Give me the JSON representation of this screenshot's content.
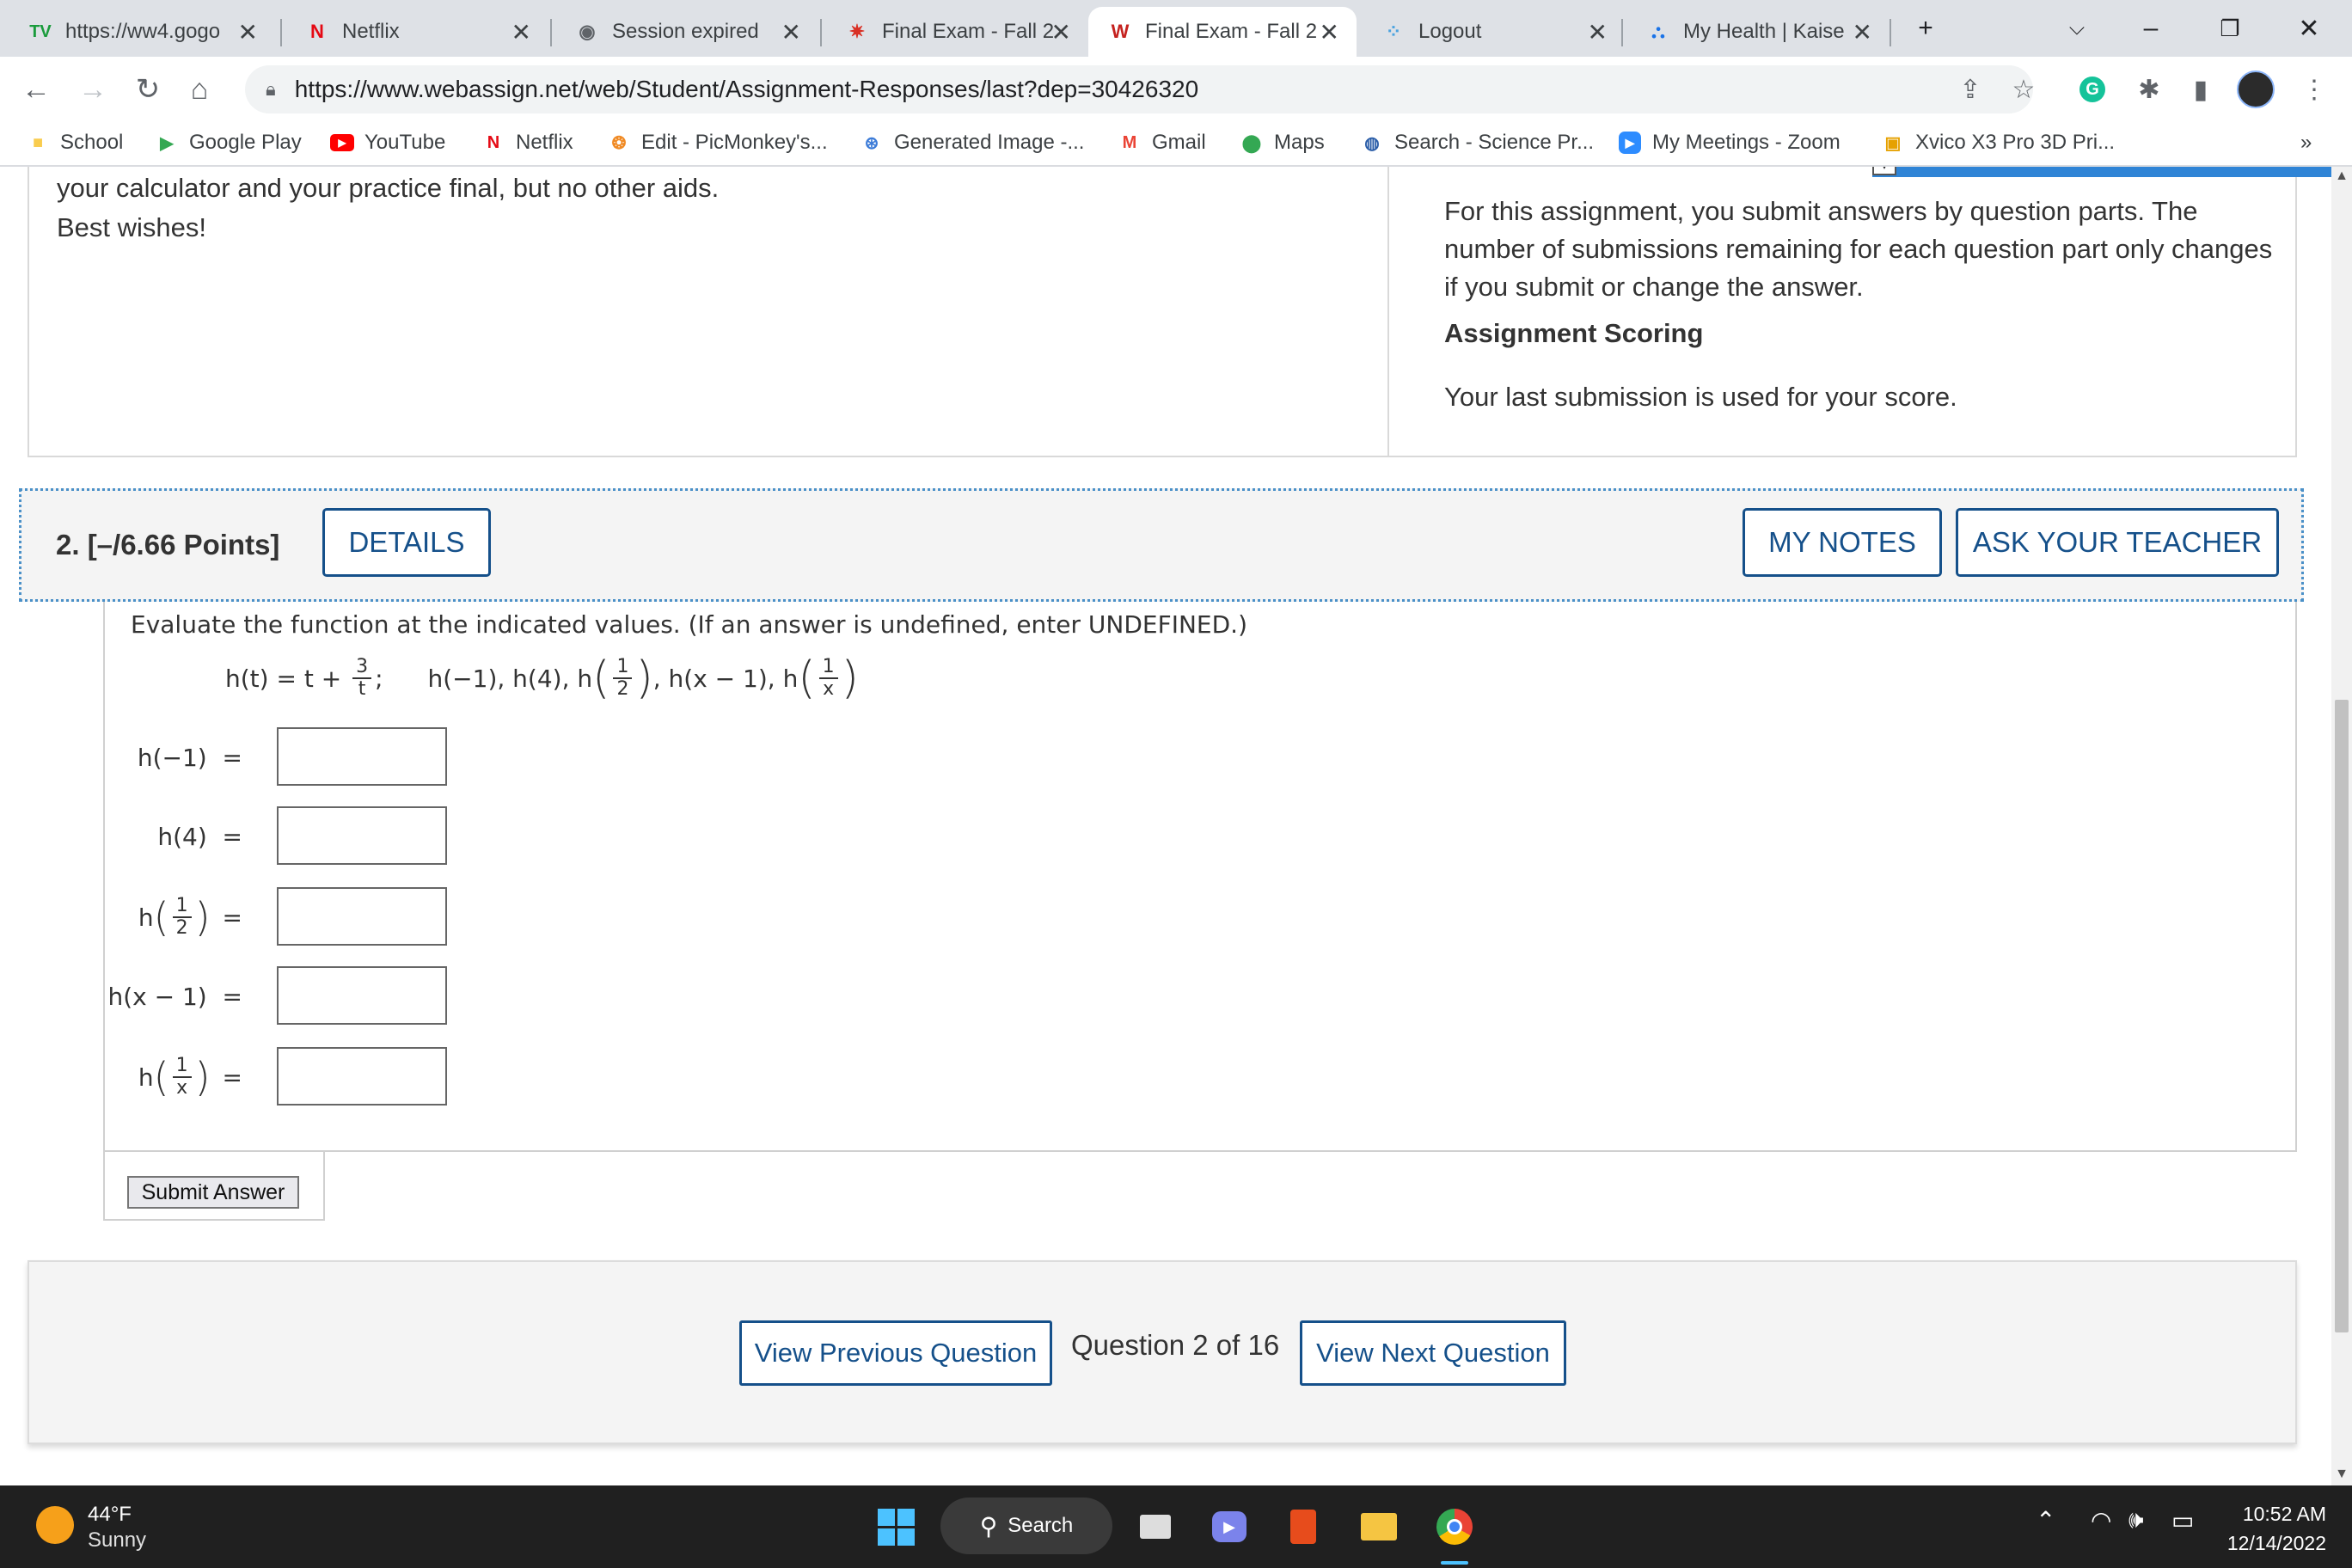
{
  "browser": {
    "tabs": [
      {
        "title": "https://ww4.gogo",
        "favicon": "tv-icon",
        "active": false
      },
      {
        "title": "Netflix",
        "favicon": "netflix-icon",
        "active": false
      },
      {
        "title": "Session expired",
        "favicon": "globe-icon",
        "active": false
      },
      {
        "title": "Final Exam - Fall 2",
        "favicon": "gear-logo-icon",
        "active": false
      },
      {
        "title": "Final Exam - Fall 2",
        "favicon": "webassign-icon",
        "active": true
      },
      {
        "title": "Logout",
        "favicon": "dots-icon",
        "active": false
      },
      {
        "title": "My Health | Kaise",
        "favicon": "kaiser-icon",
        "active": false
      }
    ],
    "new_tab_label": "+",
    "url": "https://www.webassign.net/web/Student/Assignment-Responses/last?dep=30426320",
    "bookmarks": [
      {
        "label": "School",
        "icon": "folder-icon"
      },
      {
        "label": "Google Play",
        "icon": "play-icon"
      },
      {
        "label": "YouTube",
        "icon": "youtube-icon"
      },
      {
        "label": "Netflix",
        "icon": "netflix-icon"
      },
      {
        "label": "Edit - PicMonkey's...",
        "icon": "picmonkey-icon"
      },
      {
        "label": "Generated Image -...",
        "icon": "image-icon"
      },
      {
        "label": "Gmail",
        "icon": "gmail-icon"
      },
      {
        "label": "Maps",
        "icon": "maps-pin-icon"
      },
      {
        "label": "Search - Science Pr...",
        "icon": "science-icon"
      },
      {
        "label": "My Meetings - Zoom",
        "icon": "zoom-icon"
      },
      {
        "label": "Xvico X3 Pro 3D Pri...",
        "icon": "bag-icon"
      }
    ],
    "bookmarks_overflow": "»"
  },
  "page": {
    "intro_lines": [
      "your calculator and your practice final, but no other aids.",
      "Best wishes!"
    ],
    "submission_info": "For this assignment, you submit answers by question parts. The number of submissions remaining for each question part only changes if you submit or change the answer.",
    "submission_info_lines": [
      "For this assignment, you submit answers by question parts. The",
      "number of submissions remaining for each question part only changes",
      "if you submit or change the answer."
    ],
    "scoring_heading": "Assignment Scoring",
    "scoring_text": "Your last submission is used for your score.",
    "question": {
      "points": "2.  [–/6.66 Points]",
      "details_label": "DETAILS",
      "my_notes_label": "MY NOTES",
      "ask_teacher_label": "ASK YOUR TEACHER",
      "prompt": "Evaluate the function at the indicated values. (If an answer is undefined, enter UNDEFINED.)",
      "function": {
        "lhs": "h(t) = t + ",
        "frac_num": "3",
        "frac_den": "t",
        "sep": ";",
        "values_text_1": "h(−1), h(4), h",
        "half_num": "1",
        "half_den": "2",
        "values_text_2": ", h(x − 1), h",
        "inv_num": "1",
        "inv_den": "x"
      },
      "answers": [
        {
          "label": "h(−1)  =",
          "value": ""
        },
        {
          "label": "h(4)  =",
          "value": ""
        },
        {
          "label_prefix": "h",
          "num": "1",
          "den": "2",
          "label_suffix": "=",
          "value": ""
        },
        {
          "label": "h(x − 1)  =",
          "value": ""
        },
        {
          "label_prefix": "h",
          "num": "1",
          "den": "x",
          "label_suffix": "=",
          "value": ""
        }
      ],
      "submit_label": "Submit Answer"
    },
    "navigation": {
      "prev_label": "View Previous Question",
      "counter": "Question 2 of 16",
      "next_label": "View Next Question"
    }
  },
  "taskbar": {
    "weather_temp": "44°F",
    "weather_desc": "Sunny",
    "search_label": "Search",
    "time": "10:52 AM",
    "date": "12/14/2022"
  },
  "colors": {
    "webassign_blue": "#15508a",
    "dotted_border": "#4a90c8",
    "taskbar": "#202020"
  }
}
